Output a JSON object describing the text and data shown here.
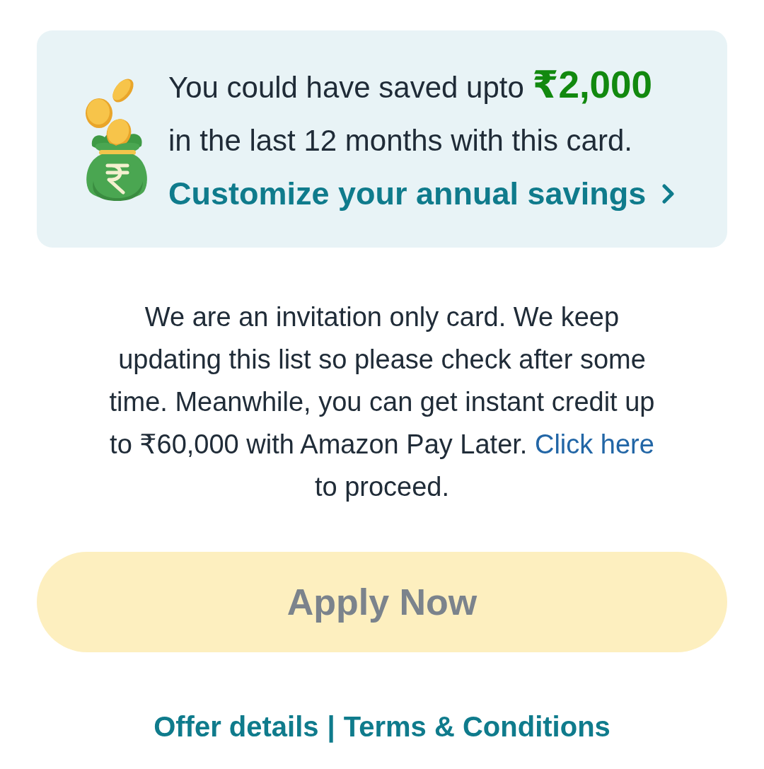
{
  "savings_card": {
    "headline": "You could have saved upto **₹2,000** in the last 12 months with this card.",
    "link": "Customize your annual savings"
  },
  "message": {
    "text": "We are an invitation only card. We keep updating this list so please check after some time. Meanwhile, you can get instant credit up to ₹60,000 with Amazon Pay Later.",
    "link": "Click here",
    "text_after": "to proceed."
  },
  "apply_button": {
    "label": "Apply Now",
    "disabled": true
  },
  "footer": {
    "links": [
      "Offer details",
      "Terms & Conditions"
    ],
    "separator": "|"
  }
}
